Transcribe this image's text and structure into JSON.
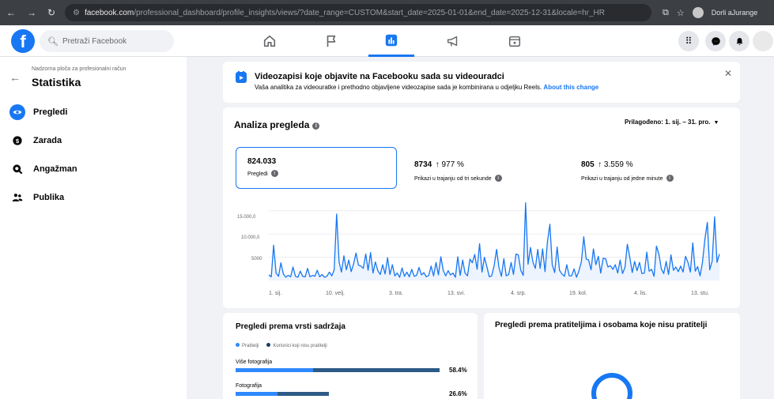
{
  "browser": {
    "url_host": "facebook.com",
    "url_path": "/professional_dashboard/profile_insights/views/?date_range=CUSTOM&start_date=2025-01-01&end_date=2025-12-31&locale=hr_HR",
    "profile_label": "Dorli aJurange"
  },
  "topbar": {
    "search_placeholder": "Pretraži Facebook",
    "tabs": [
      "home-icon",
      "flag-icon",
      "insights-icon",
      "megaphone-icon",
      "calendar-icon"
    ],
    "active_tab": "insights-icon"
  },
  "sidebar": {
    "breadcrumb": "Nadzorna ploča za profesionalni račun",
    "title": "Statistika",
    "items": [
      {
        "label": "Pregledi",
        "icon": "eye-icon",
        "active": true
      },
      {
        "label": "Zarada",
        "icon": "dollar-icon",
        "active": false
      },
      {
        "label": "Angažman",
        "icon": "engagement-icon",
        "active": false
      },
      {
        "label": "Publika",
        "icon": "people-icon",
        "active": false
      }
    ]
  },
  "banner": {
    "title": "Videozapisi koje objavite na Facebooku sada su videouradci",
    "text": "Vaša analitika za videouratke i prethodno objavljene videozapise sada je kombinirana u odjeljku Reels.",
    "link": "About this change"
  },
  "analysis": {
    "title": "Analiza pregleda",
    "range": "Prilagođeno: 1. sij. – 31. pro."
  },
  "metrics": [
    {
      "value": "824.033",
      "change": "",
      "label": "Pregledi"
    },
    {
      "value": "8734",
      "change": "↑ 977 %",
      "label": "Prikazi u trajanju od tri sekunde"
    },
    {
      "value": "805",
      "change": "↑ 3.559 %",
      "label": "Prikazi u trajanju od jedne minute"
    }
  ],
  "chart_data": {
    "type": "line",
    "y_ticks": [
      "15.000,0",
      "10.000,0",
      "5000"
    ],
    "ylim": [
      0,
      17000
    ],
    "x_ticks": [
      "1. sij.",
      "10. velj.",
      "3. tra.",
      "13. svi.",
      "4. srp.",
      "19. kol.",
      "4. lis.",
      "13. stu."
    ],
    "series": [
      {
        "values": [
          1200,
          800,
          7600,
          1600,
          900,
          3800,
          1400,
          700,
          1100,
          800,
          2900,
          900,
          700,
          2000,
          900,
          800,
          2600,
          800,
          1100,
          900,
          2200,
          800,
          1300,
          700,
          900,
          1800,
          1000,
          2300,
          14300,
          4000,
          1800,
          5300,
          2300,
          4400,
          1900,
          3600,
          5900,
          3300,
          3100,
          2600,
          5700,
          2200,
          6000,
          1600,
          4000,
          2100,
          1300,
          3400,
          1400,
          4900,
          1300,
          3400,
          1000,
          1600,
          700,
          2700,
          900,
          1800,
          800,
          2400,
          900,
          1100,
          2800,
          1200,
          1700,
          800,
          1100,
          3100,
          1000,
          3900,
          1200,
          5100,
          2200,
          1000,
          2100,
          1200,
          1600,
          700,
          5100,
          1100,
          4400,
          1600,
          1000,
          4600,
          3800,
          5600,
          2400,
          7900,
          1800,
          5000,
          3000,
          800,
          1000,
          3200,
          6700,
          2800,
          900,
          4700,
          1000,
          1300,
          3900,
          1300,
          5700,
          5500,
          2200,
          1100,
          16700,
          3500,
          7100,
          4000,
          2600,
          6700,
          2600,
          6800,
          1900,
          8300,
          12100,
          3400,
          1700,
          7200,
          2200,
          1400,
          900,
          3400,
          1000,
          1000,
          2500,
          700,
          2100,
          4000,
          9400,
          4600,
          4400,
          2300,
          6800,
          3400,
          5200,
          1600,
          4800,
          4700,
          2900,
          3200,
          2400,
          3400,
          1600,
          4400,
          1500,
          2800,
          7800,
          5000,
          1700,
          4100,
          2100,
          3900,
          1500,
          1600,
          6100,
          2000,
          2400,
          900,
          7400,
          5700,
          2500,
          1500,
          4100,
          1300,
          5500,
          2200,
          2900,
          1900,
          3100,
          1800,
          5200,
          3900,
          1800,
          8100,
          2000,
          3000,
          1000,
          3900,
          8900,
          12500,
          2300,
          4200,
          13700,
          3900,
          5700
        ]
      }
    ]
  },
  "content_type": {
    "title": "Pregledi prema vrsti sadržaja",
    "legend": [
      {
        "label": "Pratitelji",
        "color": "#2e89ff"
      },
      {
        "label": "Korisnici koji nisu pratitelji",
        "color": "#1c3d5e"
      }
    ],
    "rows": [
      {
        "label": "Više fotografija",
        "percent": "58.4%",
        "value": 58.4,
        "followers_share": 0.38
      },
      {
        "label": "Fotografija",
        "percent": "26.6%",
        "value": 26.6,
        "followers_share": 0.45
      }
    ]
  },
  "followers_section": {
    "title": "Pregledi prema pratiteljima i osobama koje nisu pratitelji"
  }
}
